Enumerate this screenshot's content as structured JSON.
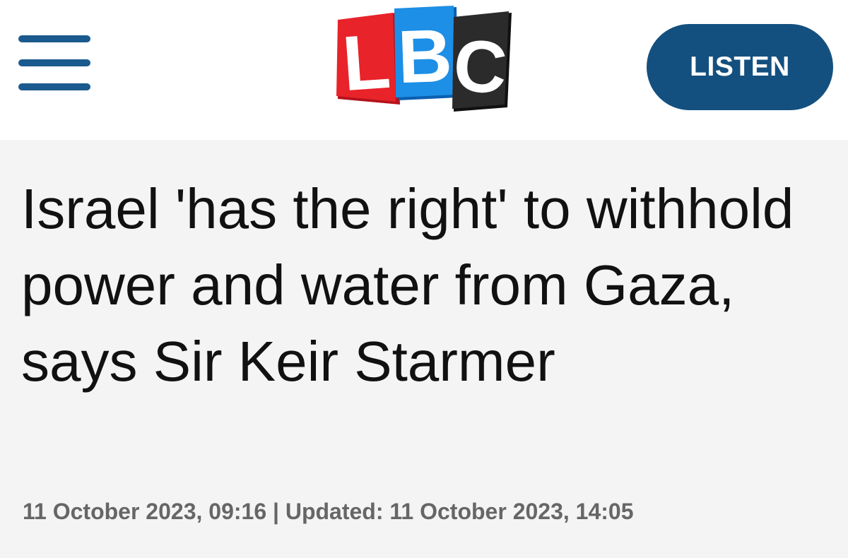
{
  "header": {
    "menu_icon": "hamburger-menu-icon",
    "logo": {
      "letters": [
        "L",
        "B",
        "C"
      ],
      "colors": [
        "#e8232a",
        "#1d8fe6",
        "#2b2b2b"
      ]
    },
    "listen_label": "LISTEN",
    "accent_color": "#14507f"
  },
  "article": {
    "headline": "Israel 'has the right' to withhold power and water from Gaza, says Sir Keir Starmer",
    "published": "11 October 2023, 09:16",
    "separator": "|",
    "updated_label": "Updated:",
    "updated": "11 October 2023, 14:05"
  }
}
